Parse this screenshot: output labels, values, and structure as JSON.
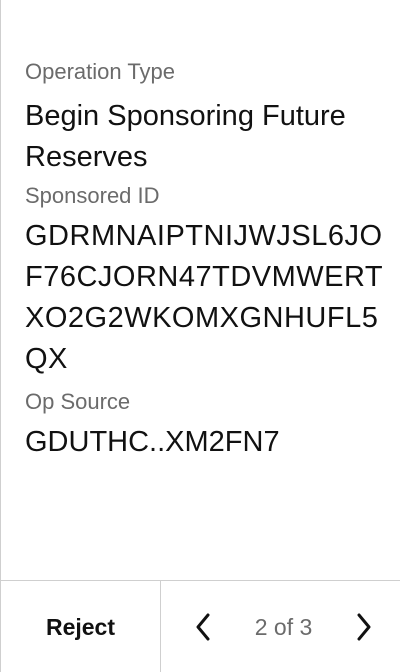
{
  "operation": {
    "type_label": "Operation Type",
    "type_value": "Begin Sponsoring Future Reserves",
    "sponsored_id_label": "Sponsored ID",
    "sponsored_id_value": "GDRMNAIPTNIJWJSL6JOF76CJORN47TDVMWERTXO2G2WKOMXGNHUFL5QX",
    "op_source_label": "Op Source",
    "op_source_value": "GDUTHC..XM2FN7"
  },
  "footer": {
    "reject_label": "Reject",
    "page_indicator": "2 of 3",
    "prev_icon": "chevron-left-icon",
    "next_icon": "chevron-right-icon"
  }
}
